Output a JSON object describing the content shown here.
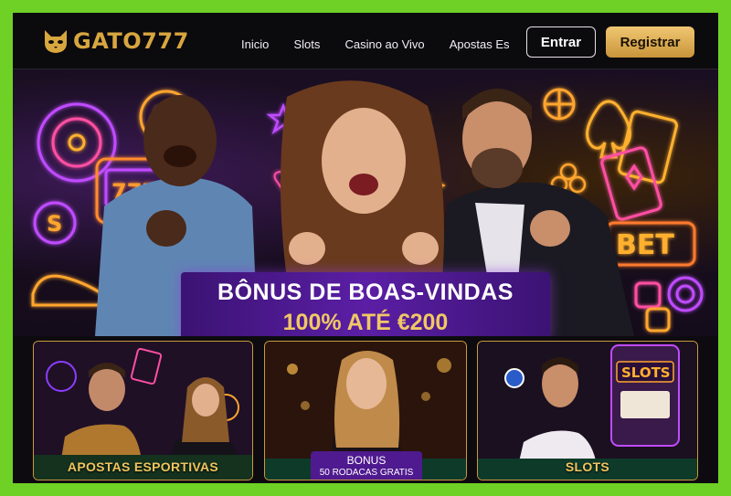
{
  "brand": {
    "name": "GATO777",
    "logo_icon": "cat-head-icon",
    "accent": "#d8a63f"
  },
  "nav": {
    "items": [
      "Inicio",
      "Slots",
      "Casino ao Vivo",
      "Apostas Es"
    ]
  },
  "actions": {
    "login": "Entrar",
    "register": "Registrar"
  },
  "hero": {
    "headline": "BÔNUS DE BOAS-VINDAS",
    "offer": "100% ATÉ €200",
    "neon_bet": "BET"
  },
  "cards": [
    {
      "label": "APOSTAS ESPORTIVAS"
    },
    {
      "badge_title": "BONUS",
      "badge_sub": "50 RODACAS GRATIS"
    },
    {
      "label": "SLOTS",
      "slot_sign": "SLOTS"
    }
  ],
  "colors": {
    "frame": "#6fd126",
    "gold": "#f0c55f",
    "purple": "#5b1ea5",
    "neon_purple": "#b340ff",
    "neon_orange": "#ff9a2e"
  }
}
